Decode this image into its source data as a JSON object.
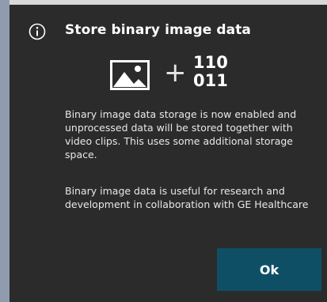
{
  "dialog": {
    "title": "Store binary image data",
    "info_icon": "info-circle-icon",
    "hero": {
      "image_icon": "image-icon",
      "plus": "+",
      "binary_line1": "110",
      "binary_line2": "011"
    },
    "paragraph1": "Binary image data storage is now enabled and unprocessed data will be stored together with video clips. This uses some additional storage space.",
    "paragraph2": "Binary image data is useful for research and development in collaboration with GE Healthcare",
    "ok_label": "Ok"
  },
  "colors": {
    "dialog_bg": "#2b2b2c",
    "button_bg": "#0f4f66",
    "text": "#ffffff"
  }
}
